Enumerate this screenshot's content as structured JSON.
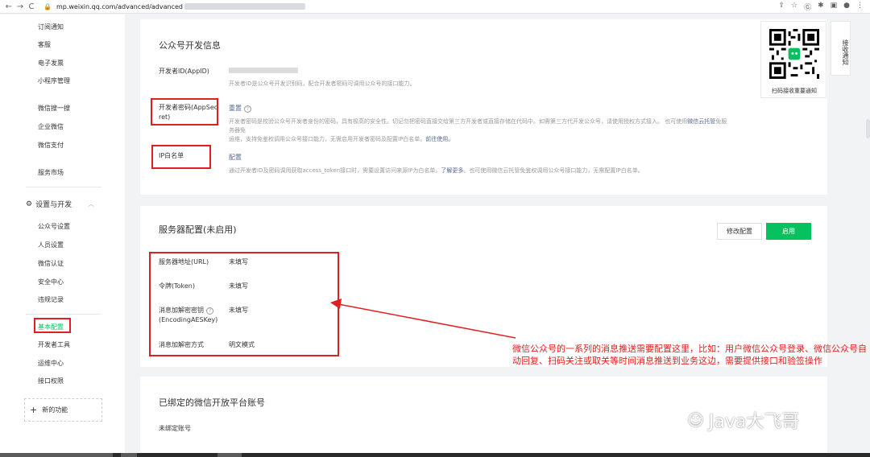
{
  "browser": {
    "url": "mp.weixin.qq.com/advanced/advanced",
    "back": "←",
    "forward": "→",
    "reload": "C",
    "lock": "🔒",
    "icons": [
      "⇪",
      "☆",
      "Ⓖ",
      "✱",
      "▣",
      "●",
      "⋮"
    ]
  },
  "sidebar": {
    "top_items": [
      "订阅通知",
      "客服",
      "电子发票",
      "小程序管理"
    ],
    "mid_items": [
      "微信搜一搜",
      "企业微信",
      "微信支付"
    ],
    "market": "服务市场",
    "section": "设置与开发",
    "section_icon": "⚙",
    "section_chevron": "︿",
    "sub_items": [
      "公众号设置",
      "人员设置",
      "微信认证",
      "安全中心",
      "违规记录"
    ],
    "active": "基本配置",
    "dev_items": [
      "开发者工具",
      "运维中心",
      "接口权限"
    ],
    "new_feature": "新的功能",
    "new_icon": "+"
  },
  "dev_info": {
    "title": "公众号开发信息",
    "appid_label": "开发者ID(AppID)",
    "appid_desc": "开发者ID是公众号开发识别码，配合开发者密码可调用公众号的接口能力。",
    "secret_label_1": "开发者密码(AppSec",
    "secret_label_2": "ret)",
    "secret_action": "重置",
    "help": "?",
    "secret_desc_1": "开发者密码是校验公众号开发者身份的密码，具有极高的安全性。切记勿把密码直接交给第三方开发者或直接存储在代码中。如需第三方代开发公众号，请使用授权方式接入。 也可使用",
    "secret_desc_link": "微信云托管",
    "secret_desc_2": "免服务器免",
    "secret_desc_3": "运维，支持免鉴权调用公众号接口能力，无需启用开发者密码及配置IP白名单。",
    "secret_desc_link2": "前往使用。",
    "ip_label": "IP白名单",
    "ip_action": "配置",
    "ip_desc_1": "通过开发者ID及密码调用获取access_token接口时，需要设置访问来源IP为白名单。",
    "ip_desc_link": "了解更多",
    "ip_desc_2": "。也可使用微信云托管免鉴权调用公众号接口能力，无需配置IP白名单。"
  },
  "qr": {
    "caption": "扫码接收重要通知",
    "notify_tab": "接收通知"
  },
  "server": {
    "title": "服务器配置(未启用)",
    "modify": "修改配置",
    "enable": "启用",
    "url_label": "服务器地址(URL)",
    "url_value": "未填写",
    "token_label": "令牌(Token)",
    "token_value": "未填写",
    "aes_label_1": "消息加解密密钥",
    "aes_label_2": "(EncodingAESKey)",
    "aes_value": "未填写",
    "mode_label": "消息加解密方式",
    "mode_value": "明文模式"
  },
  "bound": {
    "title": "已绑定的微信开放平台账号",
    "value": "未绑定账号"
  },
  "annotation": "微信公众号的一系列的消息推送需要配置这里，比如：用户微信公众号登录、微信公众号自动回复、扫码关注或取关等时间消息推送到业务这边，需要提供接口和验签操作",
  "watermark": "Java大飞哥",
  "watermark_icon": "☺",
  "colors": {
    "accent_red": "#e02020",
    "brand_green": "#07c160",
    "link_blue": "#576b95"
  }
}
